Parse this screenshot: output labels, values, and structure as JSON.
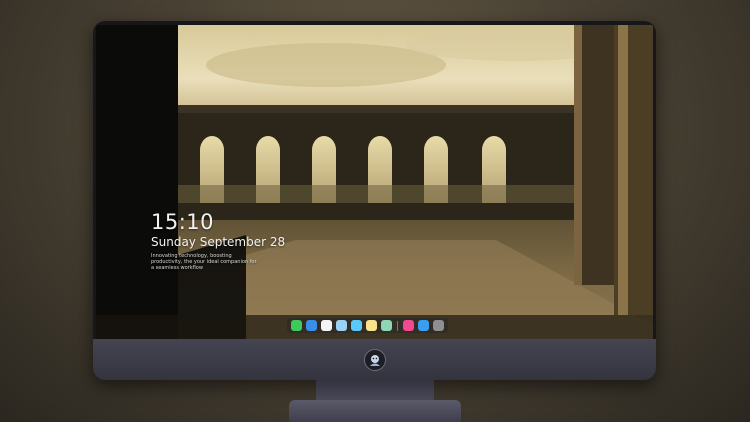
{
  "lock_screen": {
    "time": "15:10",
    "date": "Sunday September 28",
    "tagline": "Innovating technology, boosting productivity, the your ideal companion for a seamless workflow"
  },
  "dock": {
    "icons": [
      {
        "name": "messages-icon",
        "color": "#3ccb5a"
      },
      {
        "name": "finder-icon",
        "color": "#3b8ee8"
      },
      {
        "name": "clock-icon",
        "color": "#f4f4f4"
      },
      {
        "name": "notes-icon",
        "color": "#9bd1f5"
      },
      {
        "name": "files-icon",
        "color": "#5ac8fa"
      },
      {
        "name": "stickies-icon",
        "color": "#f7e38a"
      },
      {
        "name": "gallery-icon",
        "color": "#8fd6b4"
      },
      {
        "name": "music-icon",
        "color": "#f1488f"
      },
      {
        "name": "app-store-icon",
        "color": "#3a9df0"
      },
      {
        "name": "camera-icon",
        "color": "#8e8e93"
      }
    ]
  },
  "colors": {
    "background": "#4a4234",
    "monitor_bezel": "#17171b",
    "monitor_chin": "#3d3d49",
    "lock_text": "#f2f2f2"
  }
}
